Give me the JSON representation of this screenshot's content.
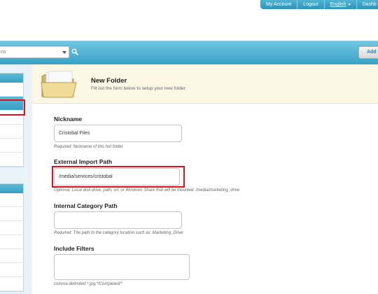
{
  "topnav": {
    "my_account": "My Account",
    "logout": "Logout",
    "language": "English",
    "dashboard": "Dashb"
  },
  "header": {
    "search_text": "ns",
    "add_label": "Add"
  },
  "banner": {
    "title": "New Folder",
    "subtitle": "Fill out the form below to setup your new folder."
  },
  "form": {
    "nickname": {
      "label": "Nickname",
      "value": "Cristobal Files",
      "help": "Required: Nickname of this hot folder"
    },
    "import_path": {
      "label": "External Import Path",
      "value": "/media/services/cristobal",
      "help": "Optional: Local disk drive, path, url, or Windows Share that will be mounted. /media/marketing_drive"
    },
    "category_path": {
      "label": "Internal Category Path",
      "value": "",
      "help": "Required: The path to the category location such as: Marketing_Drive"
    },
    "include_filters": {
      "label": "Include Filters",
      "value": "",
      "help": "comma delimited *.jpg,*/Completed/*"
    }
  },
  "colors": {
    "accent": "#3aa2c7",
    "highlight": "#e3101b",
    "banner_bg": "#fbf7e4"
  }
}
